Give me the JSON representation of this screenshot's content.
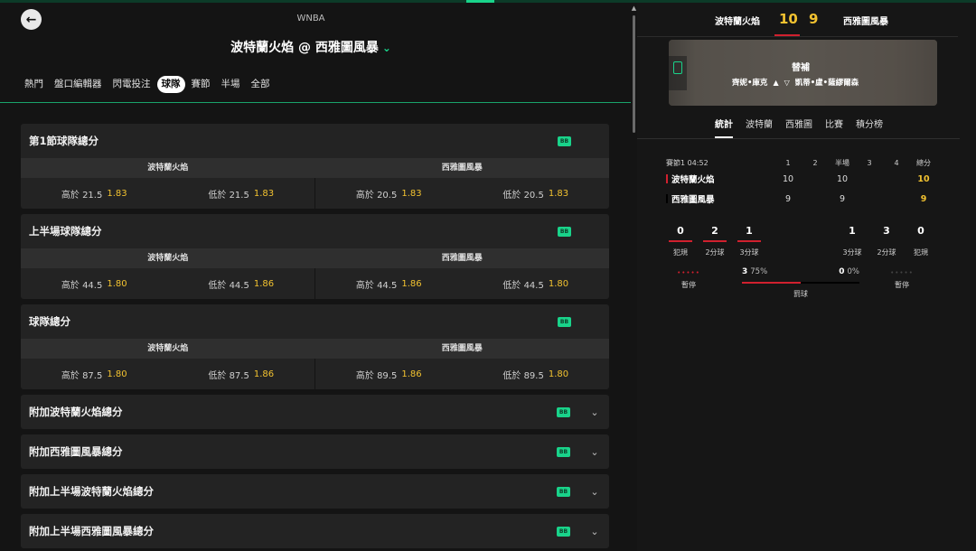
{
  "header": {
    "league": "WNBA",
    "match_title": "波特蘭火焰 @ 西雅圖風暴",
    "tabs": [
      {
        "label": "熱門",
        "active": false
      },
      {
        "label": "盤口編輯器",
        "active": false
      },
      {
        "label": "閃電投注",
        "active": false
      },
      {
        "label": "球隊",
        "active": true
      },
      {
        "label": "賽節",
        "active": false
      },
      {
        "label": "半場",
        "active": false
      },
      {
        "label": "全部",
        "active": false
      }
    ]
  },
  "markets": [
    {
      "title": "第1節球隊總分",
      "badge": "BB",
      "teams": [
        "波特蘭火焰",
        "西雅圖風暴"
      ],
      "odds": [
        {
          "label": "高於 21.5",
          "price": "1.83"
        },
        {
          "label": "低於 21.5",
          "price": "1.83"
        },
        {
          "label": "高於 20.5",
          "price": "1.83"
        },
        {
          "label": "低於 20.5",
          "price": "1.83"
        }
      ]
    },
    {
      "title": "上半場球隊總分",
      "badge": "BB",
      "teams": [
        "波特蘭火焰",
        "西雅圖風暴"
      ],
      "odds": [
        {
          "label": "高於 44.5",
          "price": "1.80"
        },
        {
          "label": "低於 44.5",
          "price": "1.86"
        },
        {
          "label": "高於 44.5",
          "price": "1.86"
        },
        {
          "label": "低於 44.5",
          "price": "1.80"
        }
      ]
    },
    {
      "title": "球隊總分",
      "badge": "BB",
      "teams": [
        "波特蘭火焰",
        "西雅圖風暴"
      ],
      "odds": [
        {
          "label": "高於 87.5",
          "price": "1.80"
        },
        {
          "label": "低於 87.5",
          "price": "1.86"
        },
        {
          "label": "高於 89.5",
          "price": "1.86"
        },
        {
          "label": "低於 89.5",
          "price": "1.80"
        }
      ]
    }
  ],
  "collapsed_markets": [
    {
      "title": "附加波特蘭火焰總分",
      "badge": "BB"
    },
    {
      "title": "附加西雅圖風暴總分",
      "badge": "BB"
    },
    {
      "title": "附加上半場波特蘭火焰總分",
      "badge": "BB"
    },
    {
      "title": "附加上半場西雅圖風暴總分",
      "badge": "BB"
    }
  ],
  "scoreboard": {
    "team1": "波特蘭火焰",
    "team2": "西雅圖風暴",
    "score1": "10",
    "score2": "9",
    "court": {
      "event": "替補",
      "player_out": "齊妮•庫克",
      "player_in": "凱蒂•盧•薩繆爾森"
    },
    "tabs": [
      {
        "label": "統計",
        "active": true
      },
      {
        "label": "波特蘭",
        "active": false
      },
      {
        "label": "西雅圖",
        "active": false
      },
      {
        "label": "比賽",
        "active": false
      },
      {
        "label": "積分榜",
        "active": false
      }
    ],
    "boxscore": {
      "period_label": "賽節1 04:52",
      "columns": [
        "1",
        "2",
        "半場",
        "3",
        "4",
        "總分"
      ],
      "rows": [
        {
          "team": "波特蘭火焰",
          "q1": "10",
          "q2": "",
          "half": "10",
          "q3": "",
          "q4": "",
          "total": "10"
        },
        {
          "team": "西雅圖風暴",
          "q1": "9",
          "q2": "",
          "half": "9",
          "q3": "",
          "q4": "",
          "total": "9"
        }
      ]
    },
    "compare_stats": {
      "team1": [
        {
          "value": "0",
          "label": "犯規"
        },
        {
          "value": "2",
          "label": "2分球"
        },
        {
          "value": "1",
          "label": "3分球"
        }
      ],
      "team2": [
        {
          "value": "1",
          "label": "3分球"
        },
        {
          "value": "3",
          "label": "2分球"
        },
        {
          "value": "0",
          "label": "犯規"
        }
      ]
    },
    "timeouts_label": "暫停",
    "free_throws": {
      "team1_made": "3",
      "team1_pct": "75%",
      "team2_made": "0",
      "team2_pct": "0%",
      "team1_fraction": 0.5,
      "label": "罰球"
    },
    "colors": {
      "team1": "#d0202e",
      "team2": "#000000",
      "accent": "#19d38a",
      "odds": "#f2c230"
    }
  }
}
